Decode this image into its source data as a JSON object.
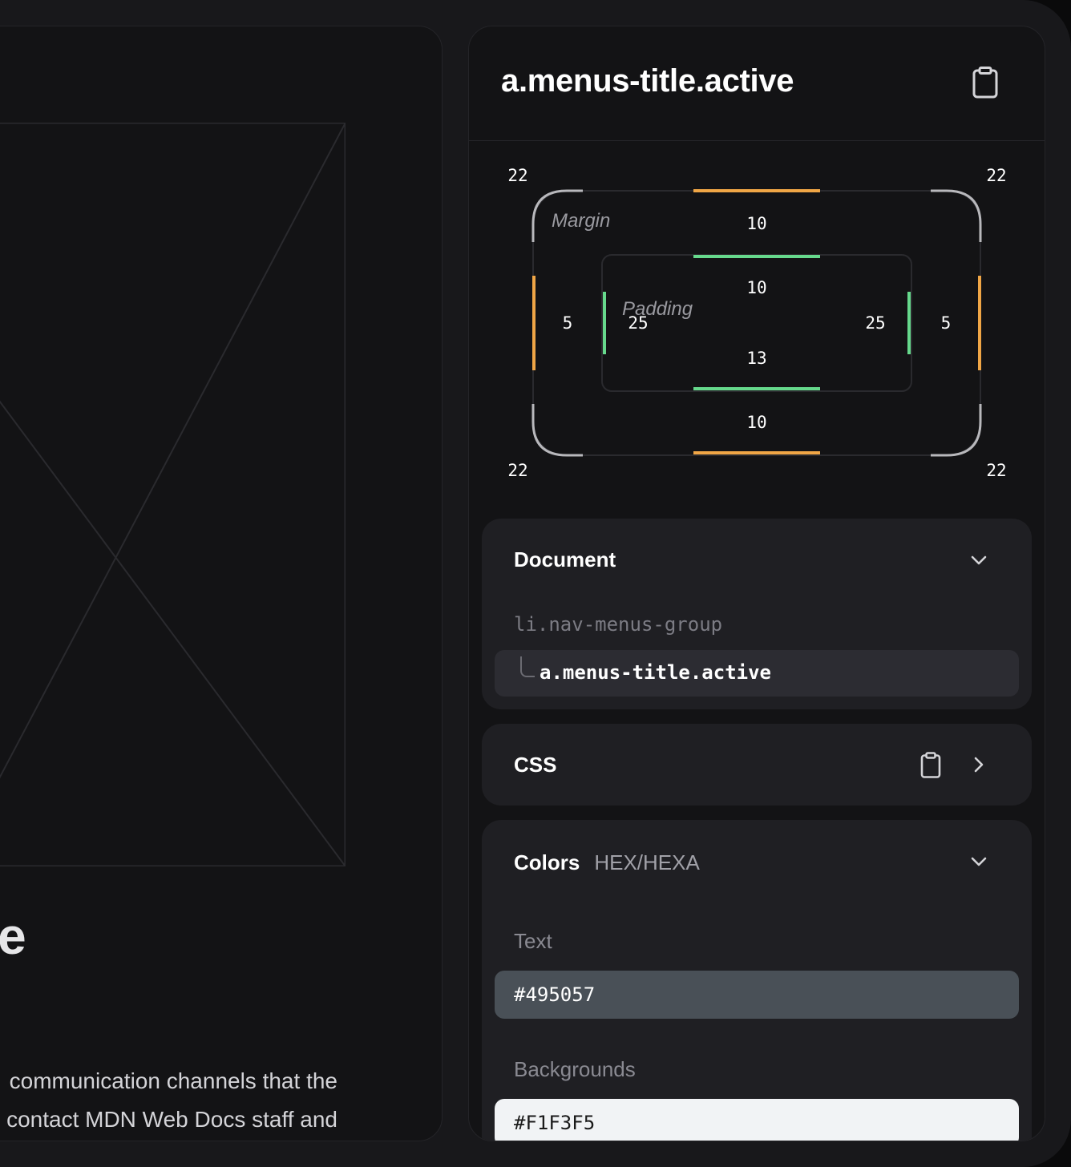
{
  "preview": {
    "heading": "website",
    "body_lines": [
      "communication channels that the",
      "contact MDN Web Docs staff and"
    ]
  },
  "inspector": {
    "title": "a.menus-title.active",
    "copy_icon": "clipboard-icon",
    "box_model": {
      "radius": {
        "top_left": "22",
        "top_right": "22",
        "bottom_left": "22",
        "bottom_right": "22"
      },
      "margin": {
        "label": "Margin",
        "top": "10",
        "right": "5",
        "bottom": "10",
        "left": "5"
      },
      "padding": {
        "label": "Padding",
        "top": "10",
        "right": "25",
        "bottom": "13",
        "left": "25"
      },
      "colors": {
        "margin": "#f0a646",
        "padding": "#66d98c"
      }
    },
    "document": {
      "title": "Document",
      "parent": "li.nav-menus-group",
      "current": "a.menus-title.active",
      "toggle_icon": "chevron-down-icon"
    },
    "css": {
      "title": "CSS",
      "copy_icon": "clipboard-icon",
      "toggle_icon": "chevron-right-icon"
    },
    "colors": {
      "title": "Colors",
      "format": "HEX/HEXA",
      "toggle_icon": "chevron-down-icon",
      "text_label": "Text",
      "text_values": [
        {
          "hex": "#495057",
          "swatch": "#495057"
        }
      ],
      "bg_label": "Backgrounds",
      "bg_values": [
        {
          "hex": "#F1F3F5",
          "swatch": "#F1F3F5"
        }
      ]
    }
  }
}
